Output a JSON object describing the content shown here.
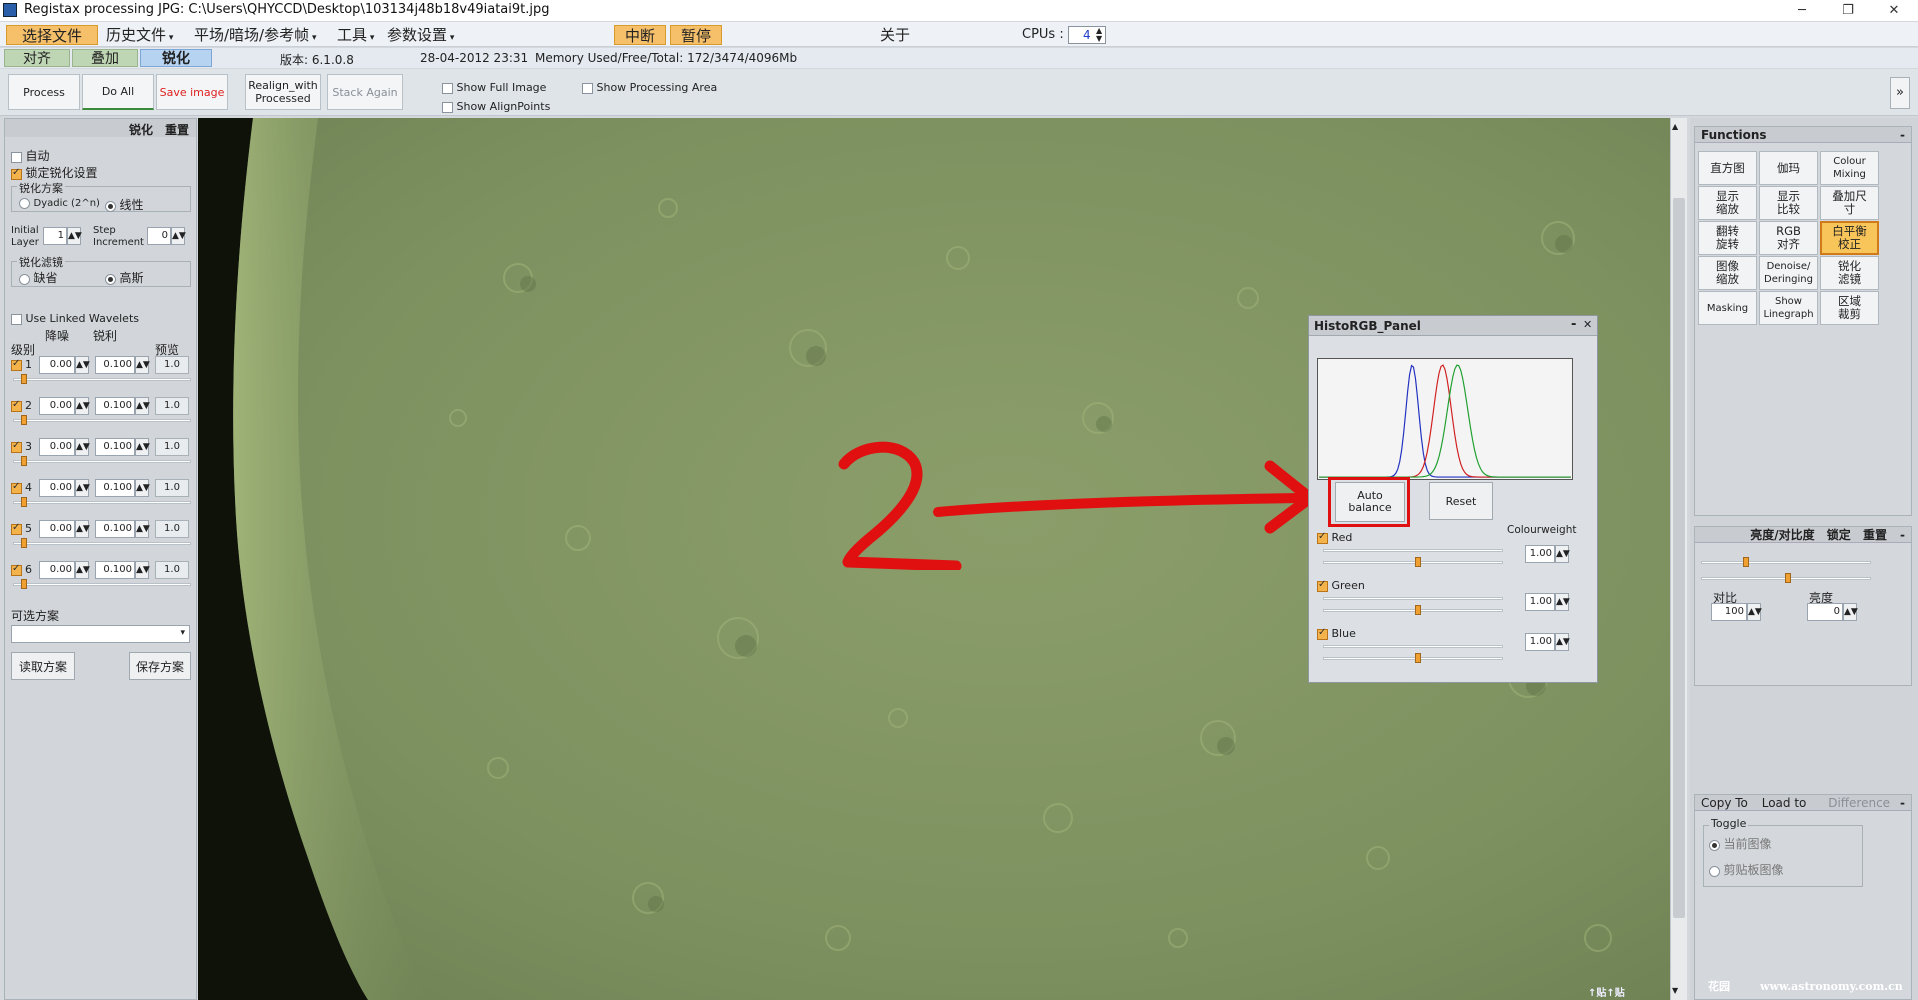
{
  "title_bar": {
    "title": "Registax processing JPG: C:\\Users\\QHYCCD\\Desktop\\103134j48b18v49iatai9t.jpg",
    "minimize": "─",
    "maximize": "❐",
    "close": "✕"
  },
  "menu": {
    "select_file": "选择文件",
    "history": "历史文件",
    "flat_dark_ref": "平场/暗场/参考帧",
    "tools": "工具",
    "params": "参数设置",
    "stop": "中断",
    "pause": "暂停",
    "about": "关于",
    "cpus_label": "CPUs :",
    "cpus_value": "4"
  },
  "tabs": {
    "align": "对齐",
    "stack": "叠加",
    "sharpen": "锐化"
  },
  "status": {
    "version": "版本: 6.1.0.8",
    "datetime": "28-04-2012 23:31",
    "memory": "Memory Used/Free/Total: 172/3474/4096Mb"
  },
  "toolbar": {
    "process": "Process",
    "do_all": "Do All",
    "save_image": "Save image",
    "realign_line1": "Realign_with",
    "realign_line2": "Processed",
    "stack_again": "Stack Again",
    "show_full_image": "Show Full Image",
    "show_alignpoints": "Show AlignPoints",
    "show_processing_area": "Show Processing Area",
    "expand": "»"
  },
  "left_panel": {
    "header_sharpen": "锐化",
    "header_reset": "重置",
    "auto": "自动",
    "lock_sharpen": "锁定锐化设置",
    "scheme_group": "锐化方案",
    "dyadic": "Dyadic (2^n)",
    "linear": "线性",
    "initial_layer_1": "Initial",
    "initial_layer_2": "Layer",
    "initial_layer_value": "1",
    "step_increment_1": "Step",
    "step_increment_2": "Increment",
    "step_increment_value": "0",
    "filter_group": "锐化滤镜",
    "default_filter": "缺省",
    "gaussian": "高斯",
    "use_linked_wavelets": "Use Linked Wavelets",
    "col_denoise": "降噪",
    "col_sharpen": "锐利",
    "col_level": "级别",
    "col_preview": "预览",
    "layers": [
      {
        "num": "1",
        "denoise": "0.00",
        "sharpen": "0.100",
        "preview": "1.0"
      },
      {
        "num": "2",
        "denoise": "0.00",
        "sharpen": "0.100",
        "preview": "1.0"
      },
      {
        "num": "3",
        "denoise": "0.00",
        "sharpen": "0.100",
        "preview": "1.0"
      },
      {
        "num": "4",
        "denoise": "0.00",
        "sharpen": "0.100",
        "preview": "1.0"
      },
      {
        "num": "5",
        "denoise": "0.00",
        "sharpen": "0.100",
        "preview": "1.0"
      },
      {
        "num": "6",
        "denoise": "0.00",
        "sharpen": "0.100",
        "preview": "1.0"
      }
    ],
    "optional_scheme": "可选方案",
    "load_scheme": "读取方案",
    "save_scheme": "保存方案"
  },
  "histo_panel": {
    "title": "HistoRGB_Panel",
    "minimize": "-",
    "close": "✕",
    "auto_balance_1": "Auto",
    "auto_balance_2": "balance",
    "reset": "Reset",
    "colourweight": "Colourweight",
    "red": "Red",
    "red_value": "1.00",
    "green": "Green",
    "green_value": "1.00",
    "blue": "Blue",
    "blue_value": "1.00"
  },
  "functions": {
    "title": "Functions",
    "collapse": "-",
    "buttons": [
      [
        "直方图",
        "伽玛",
        "Colour Mixing"
      ],
      [
        "显示 缩放",
        "显示 比较",
        "叠加尺 寸"
      ],
      [
        "翻转 旋转",
        "RGB 对齐",
        "白平衡 校正"
      ],
      [
        "图像 缩放",
        "Denoise/ Deringing",
        "锐化 滤镜"
      ],
      [
        "Masking",
        "Show Linegraph",
        "区域 裁剪"
      ]
    ]
  },
  "brightness": {
    "title": "亮度/对比度",
    "lock": "锁定",
    "reset": "重置",
    "collapse": "-",
    "contrast_label": "对比",
    "contrast_value": "100",
    "brightness_label": "亮度",
    "brightness_value": "0"
  },
  "copy_panel": {
    "copy_to": "Copy To",
    "load_to": "Load to",
    "difference": "Difference",
    "collapse": "-",
    "toggle": "Toggle",
    "current_image": "当前图像",
    "clipboard_image": "剪贴板图像"
  },
  "annotation": {
    "number": "2",
    "color": "#e01010"
  },
  "watermark": {
    "left": "↑贴↑贴",
    "right": "www.astronomy.com.cn",
    "middle": "花园"
  },
  "histogram_values": {
    "blue_peak": 0.37,
    "red_peak": 0.49,
    "green_peak": 0.55
  }
}
